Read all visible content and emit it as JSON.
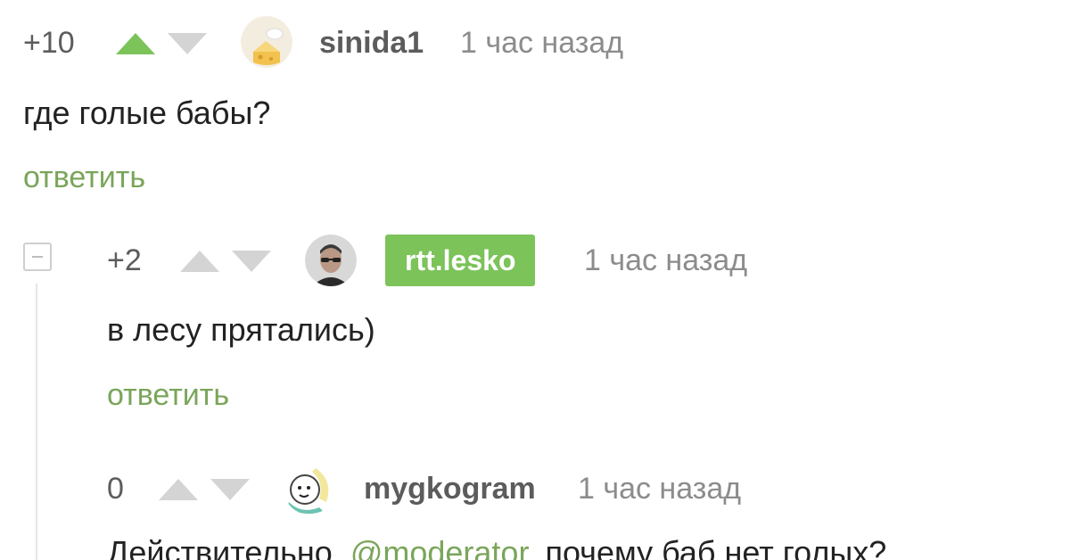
{
  "comments": [
    {
      "rating": "+10",
      "username": "sinida1",
      "time": "1 час назад",
      "text": "где голые бабы?",
      "reply_label": "ответить",
      "upvoted": true,
      "avatar_icon": "cheese-avatar-icon"
    },
    {
      "rating": "+2",
      "username": "rtt.lesko",
      "time": "1 час назад",
      "text": "в лесу прятались)",
      "reply_label": "ответить",
      "author_badge": true,
      "avatar_icon": "man-sunglasses-avatar-icon"
    },
    {
      "rating": "0",
      "username": "mygkogram",
      "time": "1 час назад",
      "text_before": "Действительно, ",
      "mention": "@moderator",
      "text_after": ", почему баб нет голых?",
      "avatar_icon": "cartoon-face-avatar-icon"
    }
  ],
  "colors": {
    "upvote_active": "#7cc35a",
    "arrow_inactive": "#d4d4d4",
    "link_green": "#7aa55a",
    "badge_green": "#7cc35a"
  }
}
